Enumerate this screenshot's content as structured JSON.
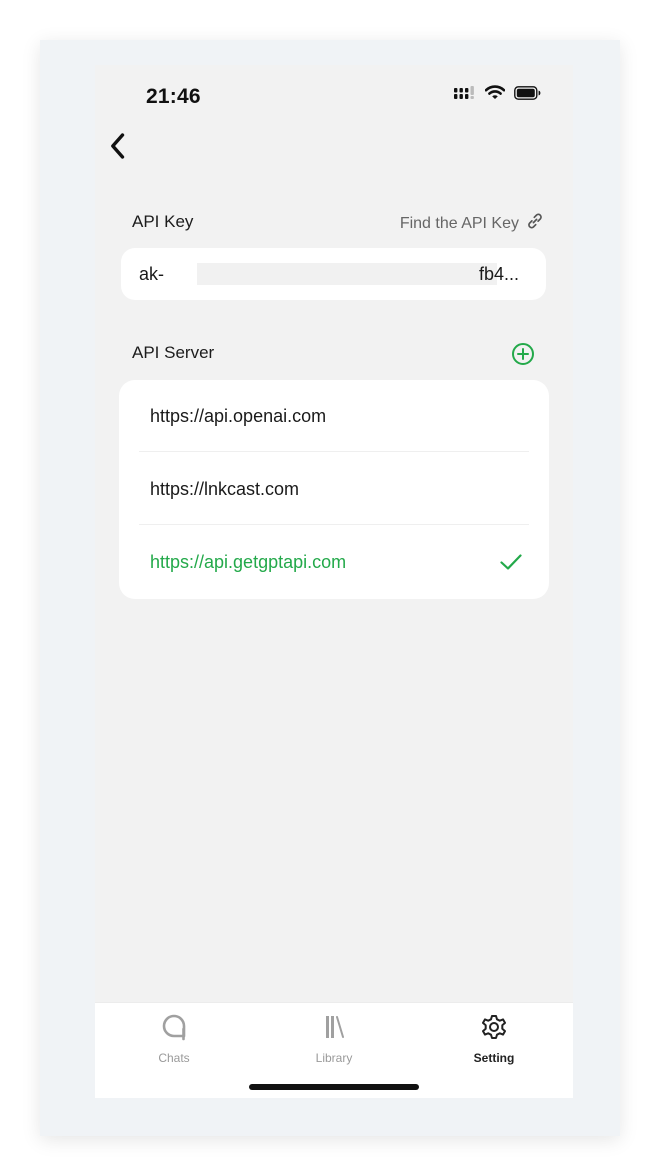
{
  "status_bar": {
    "time": "21:46"
  },
  "header": {
    "back_icon": "chevron-left-icon"
  },
  "api_key": {
    "label": "API Key",
    "find_link_label": "Find the API Key",
    "find_link_icon": "link-icon",
    "value_prefix": "ak-",
    "value_suffix": "fb4..."
  },
  "api_server": {
    "label": "API Server",
    "add_icon": "plus-circle-icon",
    "accent_color": "#23a94a",
    "servers": [
      {
        "url": "https://api.openai.com",
        "selected": false
      },
      {
        "url": "https://lnkcast.com",
        "selected": false
      },
      {
        "url": "https://api.getgptapi.com",
        "selected": true
      }
    ]
  },
  "tab_bar": {
    "tabs": [
      {
        "label": "Chats",
        "icon": "chat-bubbles-icon",
        "active": false
      },
      {
        "label": "Library",
        "icon": "library-icon",
        "active": false
      },
      {
        "label": "Setting",
        "icon": "gear-icon",
        "active": true
      }
    ]
  }
}
